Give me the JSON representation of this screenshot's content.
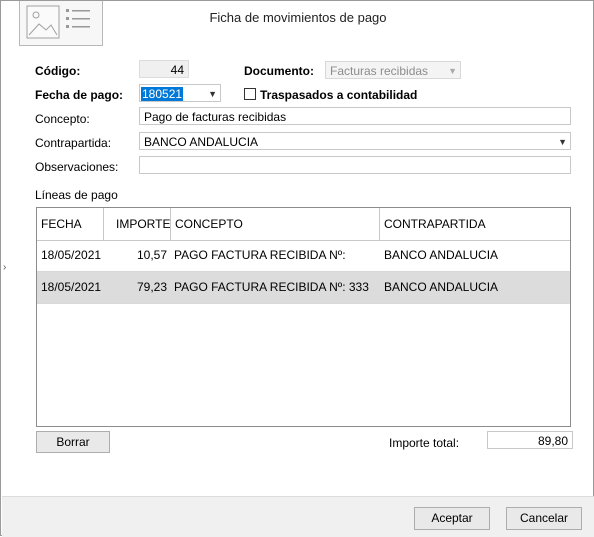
{
  "window": {
    "title": "Ficha de movimientos de pago"
  },
  "form": {
    "codigo_label": "Código:",
    "codigo_value": "44",
    "documento_label": "Documento:",
    "documento_value": "Facturas recibidas",
    "fecha_label": "Fecha de pago:",
    "fecha_value": "180521",
    "traspasados_label": "Traspasados a contabilidad",
    "traspasados_checked": false,
    "concepto_label": "Concepto:",
    "concepto_value": "Pago de facturas recibidas",
    "contrapartida_label": "Contrapartida:",
    "contrapartida_value": "BANCO ANDALUCIA",
    "observaciones_label": "Observaciones:",
    "observaciones_value": ""
  },
  "grid": {
    "section_label": "Líneas de pago",
    "columns": [
      "FECHA",
      "IMPORTE",
      "CONCEPTO",
      "CONTRAPARTIDA"
    ],
    "rows": [
      {
        "fecha": "18/05/2021",
        "importe": "10,57",
        "concepto": "PAGO FACTURA RECIBIDA Nº:",
        "contrapartida": "BANCO ANDALUCIA",
        "selected": false
      },
      {
        "fecha": "18/05/2021",
        "importe": "79,23",
        "concepto": "PAGO FACTURA RECIBIDA Nº: 333",
        "contrapartida": "BANCO ANDALUCIA",
        "selected": true
      }
    ]
  },
  "footer": {
    "borrar_label": "Borrar",
    "importe_total_label": "Importe total:",
    "importe_total_value": "89,80",
    "aceptar_label": "Aceptar",
    "cancelar_label": "Cancelar"
  },
  "icons": {
    "header_image": "image-placeholder-icon",
    "dropdown": "chevron-down-icon",
    "side": "chevron-right-icon"
  }
}
